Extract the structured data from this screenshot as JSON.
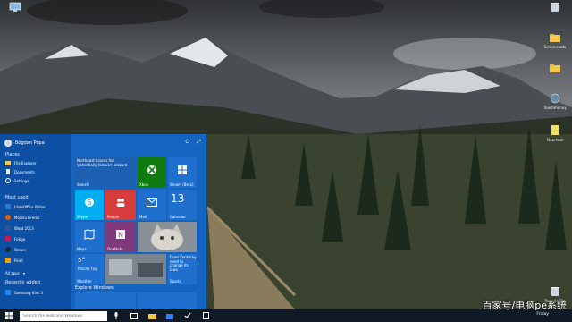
{
  "desktop": {
    "icons": [
      {
        "name": "this-pc-icon",
        "label": "",
        "color": "#8fb8e6"
      },
      {
        "name": "recycle-bin-icon",
        "label": "",
        "color": "#c9d6e4"
      },
      {
        "name": "screenshots-folder-icon",
        "label": "Screenshots",
        "color": "#f2c94c"
      },
      {
        "name": "toolbox-folder-icon",
        "label": "",
        "color": "#f2c94c"
      },
      {
        "name": "touchmonoy-icon",
        "label": "Touchmonoy",
        "color": "#6c8fb0"
      },
      {
        "name": "new-text-icon",
        "label": "New text",
        "color": "#f0e060"
      },
      {
        "name": "recycle-bin-bottom-icon",
        "label": "Recycle Bin",
        "color": "#c9d6e4"
      }
    ]
  },
  "start": {
    "user_name": "Bogdan Popa",
    "places_heading": "Places",
    "places": [
      "File Explorer",
      "Documents",
      "Settings"
    ],
    "most_used_heading": "Most used",
    "most_used": [
      "LibreOffice Writer",
      "Mozilla Firefox",
      "Word 2013",
      "Fotigo",
      "Steam",
      "Paint"
    ],
    "all_apps": "All apps",
    "recent_heading": "Recently added",
    "recent": [
      "Samsung Kies 3"
    ],
    "explore_label": "Explore Windows",
    "power_glyph": "⏻",
    "expand_glyph": "⤢",
    "tiles": {
      "news_text": "Northeast braces for 'potentially historic' blizzard",
      "search": "Search",
      "xbox": "Xbox",
      "steam": "Steam (Beta)",
      "skype": "Skype",
      "people": "People",
      "mail": "Mail",
      "calendar_day": "13",
      "calendar": "Calendar",
      "maps": "Maps",
      "onenote": "OneNote",
      "weather_temp": "5°",
      "weather_city": "Patchy Fog",
      "weather": "Weather",
      "store_text": "Does Kentucky need to change its laws",
      "sports": "Sports"
    }
  },
  "taskbar": {
    "search_placeholder": "Search the web and Windows",
    "time": "Friday"
  },
  "watermark": "百家号/电脑pe系统"
}
